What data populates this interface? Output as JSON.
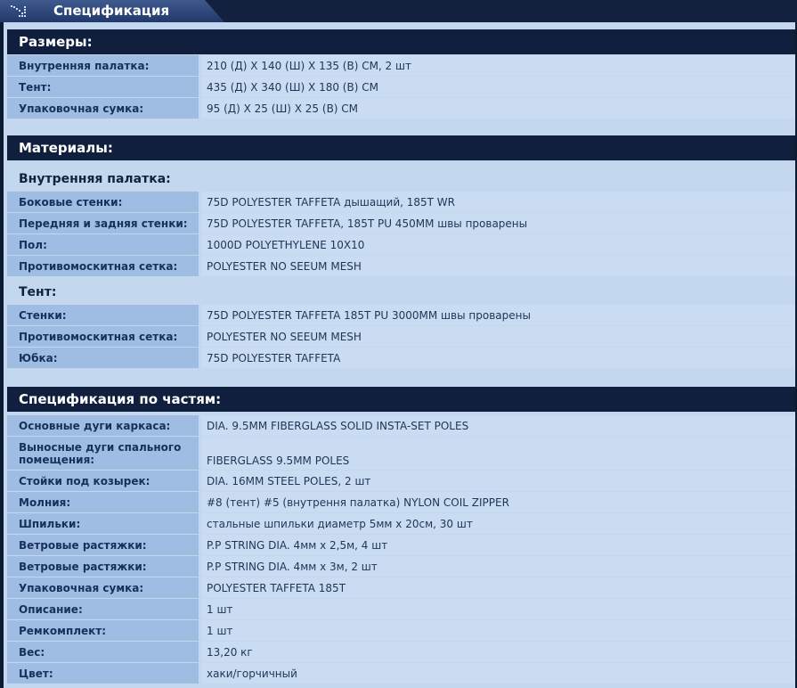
{
  "header": {
    "title": "Спецификация",
    "icon": "dotted-chart-icon"
  },
  "sections": [
    {
      "title": "Размеры:",
      "rows": [
        {
          "label": "Внутренняя палатка:",
          "value": "210 (Д) X 140 (Ш) X 135 (В) СМ, 2 шт"
        },
        {
          "label": "Тент:",
          "value": "435 (Д) X 340 (Ш) X 180 (В) СМ"
        },
        {
          "label": "Упаковочная сумка:",
          "value": "95 (Д) X 25 (Ш) X 25 (В) СМ"
        }
      ]
    },
    {
      "title": "Материалы:",
      "subsections": [
        {
          "title": "Внутренняя палатка:",
          "rows": [
            {
              "label": "Боковые стенки:",
              "value": "75D POLYESTER TAFFETA дышащий, 185T WR"
            },
            {
              "label": "Передняя и задняя стенки:",
              "value": "75D POLYESTER TAFFETA, 185T PU 450MM швы проварены"
            },
            {
              "label": "Пол:",
              "value": "1000D POLYETHYLENE 10X10"
            },
            {
              "label": "Противомоскитная сетка:",
              "value": "POLYESTER NO SEEUM MESH"
            }
          ]
        },
        {
          "title": "Тент:",
          "rows": [
            {
              "label": "Стенки:",
              "value": "75D POLYESTER TAFFETA 185T PU 3000MM швы проварены"
            },
            {
              "label": "Противомоскитная сетка:",
              "value": "POLYESTER NO SEEUM MESH"
            },
            {
              "label": "Юбка:",
              "value": "75D POLYESTER TAFFETA"
            }
          ]
        }
      ]
    },
    {
      "title": "Спецификация по частям:",
      "rows": [
        {
          "label": "Основные дуги каркаса:",
          "value": "DIA. 9.5MM FIBERGLASS SOLID INSTA-SET POLES"
        },
        {
          "label": "Выносные дуги спального помещения:",
          "value": "FIBERGLASS 9.5MM POLES"
        },
        {
          "label": "Стойки под козырек:",
          "value": "DIA. 16MM STEEL POLES, 2 шт"
        },
        {
          "label": "Молния:",
          "value": "#8 (тент) #5 (внутрення палатка) NYLON COIL ZIPPER"
        },
        {
          "label": "Шпильки:",
          "value": "стальные шпильки диаметр 5мм х 20см, 30 шт"
        },
        {
          "label": "Ветровые растяжки:",
          "value": "P.P STRING DIA. 4мм х 2,5м, 4 шт"
        },
        {
          "label": "Ветровые растяжки:",
          "value": "P.P STRING DIA. 4мм х 3м, 2 шт"
        },
        {
          "label": "Упаковочная сумка:",
          "value": "POLYESTER TAFFETA 185T"
        },
        {
          "label": "Описание:",
          "value": "1 шт"
        },
        {
          "label": "Ремкомплект:",
          "value": "1 шт"
        },
        {
          "label": "Вес:",
          "value": "13,20 кг"
        },
        {
          "label": "Цвет:",
          "value": "хаки/горчичный"
        }
      ]
    }
  ]
}
